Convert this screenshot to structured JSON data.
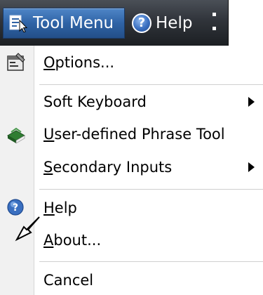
{
  "toolbar": {
    "tool_menu_label": "Tool Menu",
    "help_label": "Help",
    "help_glyph": "?"
  },
  "menu": {
    "items": [
      {
        "label": "Options...",
        "mnemonic": "O",
        "icon": "options-properties-icon"
      },
      {
        "label": "Soft Keyboard",
        "submenu": true
      },
      {
        "label": "User-defined Phrase Tool",
        "mnemonic": "U",
        "icon": "phrase-tool-book-icon"
      },
      {
        "label": "Secondary Inputs",
        "mnemonic": "S",
        "submenu": true
      },
      {
        "label": "Help",
        "mnemonic": "H",
        "icon": "help-icon"
      },
      {
        "label": "About...",
        "mnemonic": "A"
      },
      {
        "label": "Cancel"
      }
    ]
  },
  "colors": {
    "toolbar_dark": "#30343a",
    "button_blue": "#2f63a6",
    "gutter": "#f1f1f1"
  }
}
